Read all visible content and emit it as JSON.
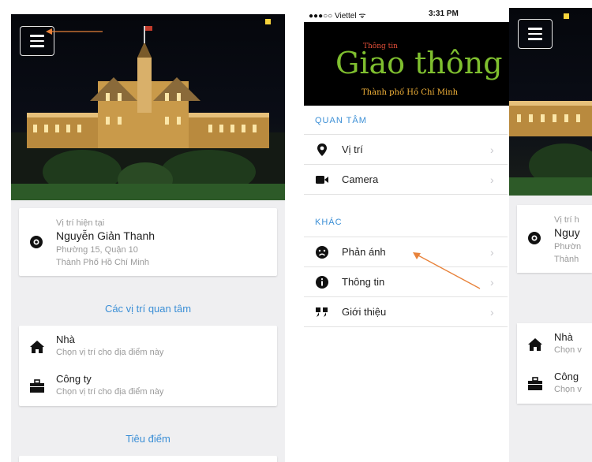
{
  "left_screen": {
    "current_location": {
      "caption": "Vị trí hiện tại",
      "name": "Nguyễn Giản Thanh",
      "line1": "Phường 15, Quận 10",
      "line2": "Thành Phố Hồ Chí Minh"
    },
    "favorites_heading": "Các vị trí quan tâm",
    "favorites": [
      {
        "title": "Nhà",
        "subtitle": "Chọn vị trí cho địa điểm này",
        "icon": "home-icon"
      },
      {
        "title": "Công ty",
        "subtitle": "Chọn vị trí cho địa điểm này",
        "icon": "briefcase-icon"
      }
    ],
    "highlights_heading": "Tiêu điểm"
  },
  "middle_screen": {
    "status_bar": {
      "carrier": "●●●○○ Viettel ᯤ",
      "time": "3:31 PM"
    },
    "banner": {
      "top_text": "Thông tin",
      "logo_text": "Giao thông",
      "city_text": "Thành phố Hồ Chí Minh"
    },
    "section_interest": "QUAN TÂM",
    "interest_items": [
      {
        "label": "Vị trí",
        "icon": "map-pin-icon"
      },
      {
        "label": "Camera",
        "icon": "video-camera-icon"
      }
    ],
    "section_other": "KHÁC",
    "other_items": [
      {
        "label": "Phản ánh",
        "icon": "sad-face-icon"
      },
      {
        "label": "Thông tin",
        "icon": "info-icon"
      },
      {
        "label": "Giới thiệu",
        "icon": "quote-icon"
      }
    ],
    "chevron": "›"
  },
  "right_screen": {
    "location_caption": "Vị trí h",
    "location_name": "Nguy",
    "location_line1": "Phườn",
    "location_line2": "Thành",
    "fav1_title": "Nhà",
    "fav1_sub": "Chọn v",
    "fav2_title": "Công",
    "fav2_sub": "Chọn v"
  },
  "colors": {
    "accent": "#3b8fd6",
    "annotation_arrow": "#e8823a",
    "logo_green": "#7fbf2f",
    "logo_orange": "#f6b53a"
  }
}
